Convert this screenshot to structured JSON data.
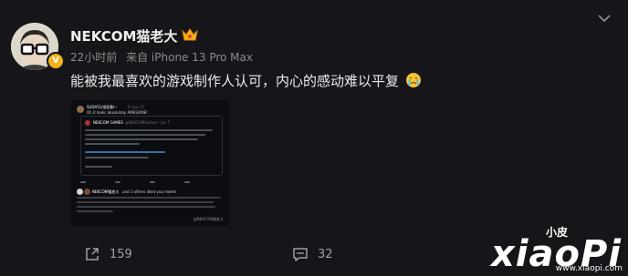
{
  "post": {
    "username": "NEKCOM猫老大",
    "time": "22小时前",
    "source": "来自 iPhone 13 Pro Max",
    "text": "能被我最喜欢的游戏制作人认可，内心的感动难以平复",
    "verified_mark": "V"
  },
  "embed": {
    "tweet_author": "SUDA51/須田剛一",
    "tweet_date": "Fri Jan 27",
    "tweet_text": "Oh it looks absolutely AWESOME!",
    "quote_author": "NEKCOM GAMES",
    "quote_handle": "@NEKCOMGames · Jan 7",
    "reply_author": "NEKCOM猫老大",
    "reply_text": "and 1 others liked your tweet",
    "watermark": "@NEKCOM猫老大"
  },
  "actions": {
    "repost_count": "159",
    "comment_count": "32"
  },
  "watermark": {
    "brand": "xiaoPi",
    "small": "小皮",
    "url": "www.xiaopi.com"
  },
  "colors": {
    "background": "#15151a",
    "crown": "#f1b318",
    "verified": "#f1b318"
  }
}
